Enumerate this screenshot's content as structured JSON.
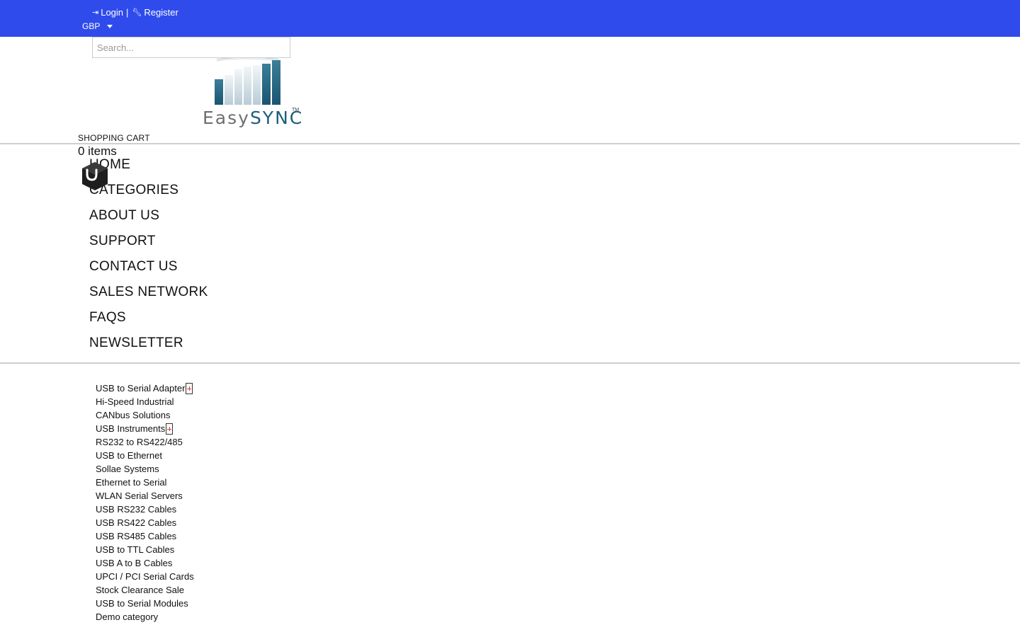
{
  "header": {
    "login_label": "Login",
    "separator": "|",
    "register_label": "Register",
    "currency": "GBP",
    "search_placeholder": "Search...",
    "logo": {
      "text_part1": "Easy",
      "text_part2": "SYNC",
      "trademark": "TM",
      "colors": {
        "easy": "#6f6f6f",
        "sync": "#1d5d7b"
      }
    },
    "topbar_color": "#2f4bec"
  },
  "cart": {
    "label": "SHOPPING CART",
    "count": "0 items",
    "icon": "shopping-bag-icon"
  },
  "nav": {
    "items": [
      {
        "label": "HOME"
      },
      {
        "label": "CATEGORIES"
      },
      {
        "label": "ABOUT US"
      },
      {
        "label": "SUPPORT"
      },
      {
        "label": "CONTACT US"
      },
      {
        "label": "SALES NETWORK"
      },
      {
        "label": "FAQS"
      },
      {
        "label": "NEWSLETTER"
      }
    ]
  },
  "categories": {
    "items": [
      {
        "label": "USB to Serial Adapter",
        "expandable": true
      },
      {
        "label": "Hi-Speed Industrial"
      },
      {
        "label": "CANbus Solutions"
      },
      {
        "label": "USB Instruments",
        "expandable": true
      },
      {
        "label": "RS232 to RS422/485"
      },
      {
        "label": "USB to Ethernet"
      },
      {
        "label": "Sollae Systems"
      },
      {
        "label": "Ethernet to Serial"
      },
      {
        "label": "WLAN Serial Servers"
      },
      {
        "label": "USB RS232 Cables"
      },
      {
        "label": "USB RS422 Cables"
      },
      {
        "label": "USB RS485 Cables"
      },
      {
        "label": "USB to TTL Cables"
      },
      {
        "label": "USB A to B Cables"
      },
      {
        "label": "UPCI / PCI Serial Cards"
      },
      {
        "label": "Stock Clearance Sale"
      },
      {
        "label": "USB to Serial Modules"
      },
      {
        "label": "Demo category"
      }
    ]
  }
}
